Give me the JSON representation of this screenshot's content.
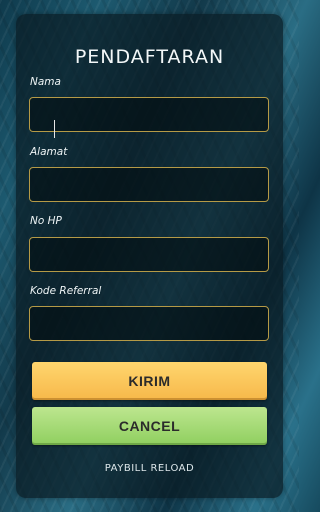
{
  "form": {
    "title": "PENDAFTARAN",
    "fields": [
      {
        "label": "Nama",
        "value": "",
        "placeholder": ""
      },
      {
        "label": "Alamat",
        "value": "",
        "placeholder": ""
      },
      {
        "label": "No HP",
        "value": "",
        "placeholder": ""
      },
      {
        "label": "Kode Referral",
        "value": "",
        "placeholder": ""
      }
    ],
    "submit_label": "KIRIM",
    "cancel_label": "CANCEL",
    "footer_text": "PAYBILL RELOAD"
  },
  "colors": {
    "submit_button": "#f9c55a",
    "cancel_button": "#a6dc76",
    "field_border": "#b59a46",
    "panel_background": "#0a1c24"
  }
}
